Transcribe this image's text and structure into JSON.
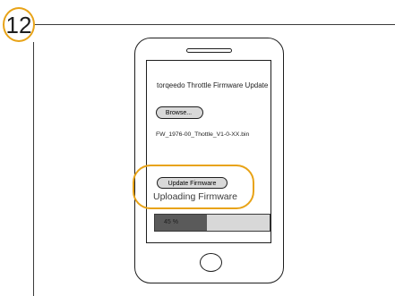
{
  "step": {
    "number": "12"
  },
  "screen": {
    "title": "torqeedo Throttle Firmware Update",
    "browse_label": "Browse...",
    "filename": "FW_1976-00_Thottle_V1-0-XX.bin",
    "update_button_label": "Update Firmware",
    "status_text": "Uploading Firmware",
    "progress": {
      "percent": 45,
      "label": "45 %"
    }
  },
  "colors": {
    "accent": "#e8a317",
    "progress_fill": "#5a5a5a",
    "progress_track": "#d8d8d8",
    "button_fill": "#d9d9d9"
  },
  "icons": {
    "home_button": "home-button-icon"
  }
}
